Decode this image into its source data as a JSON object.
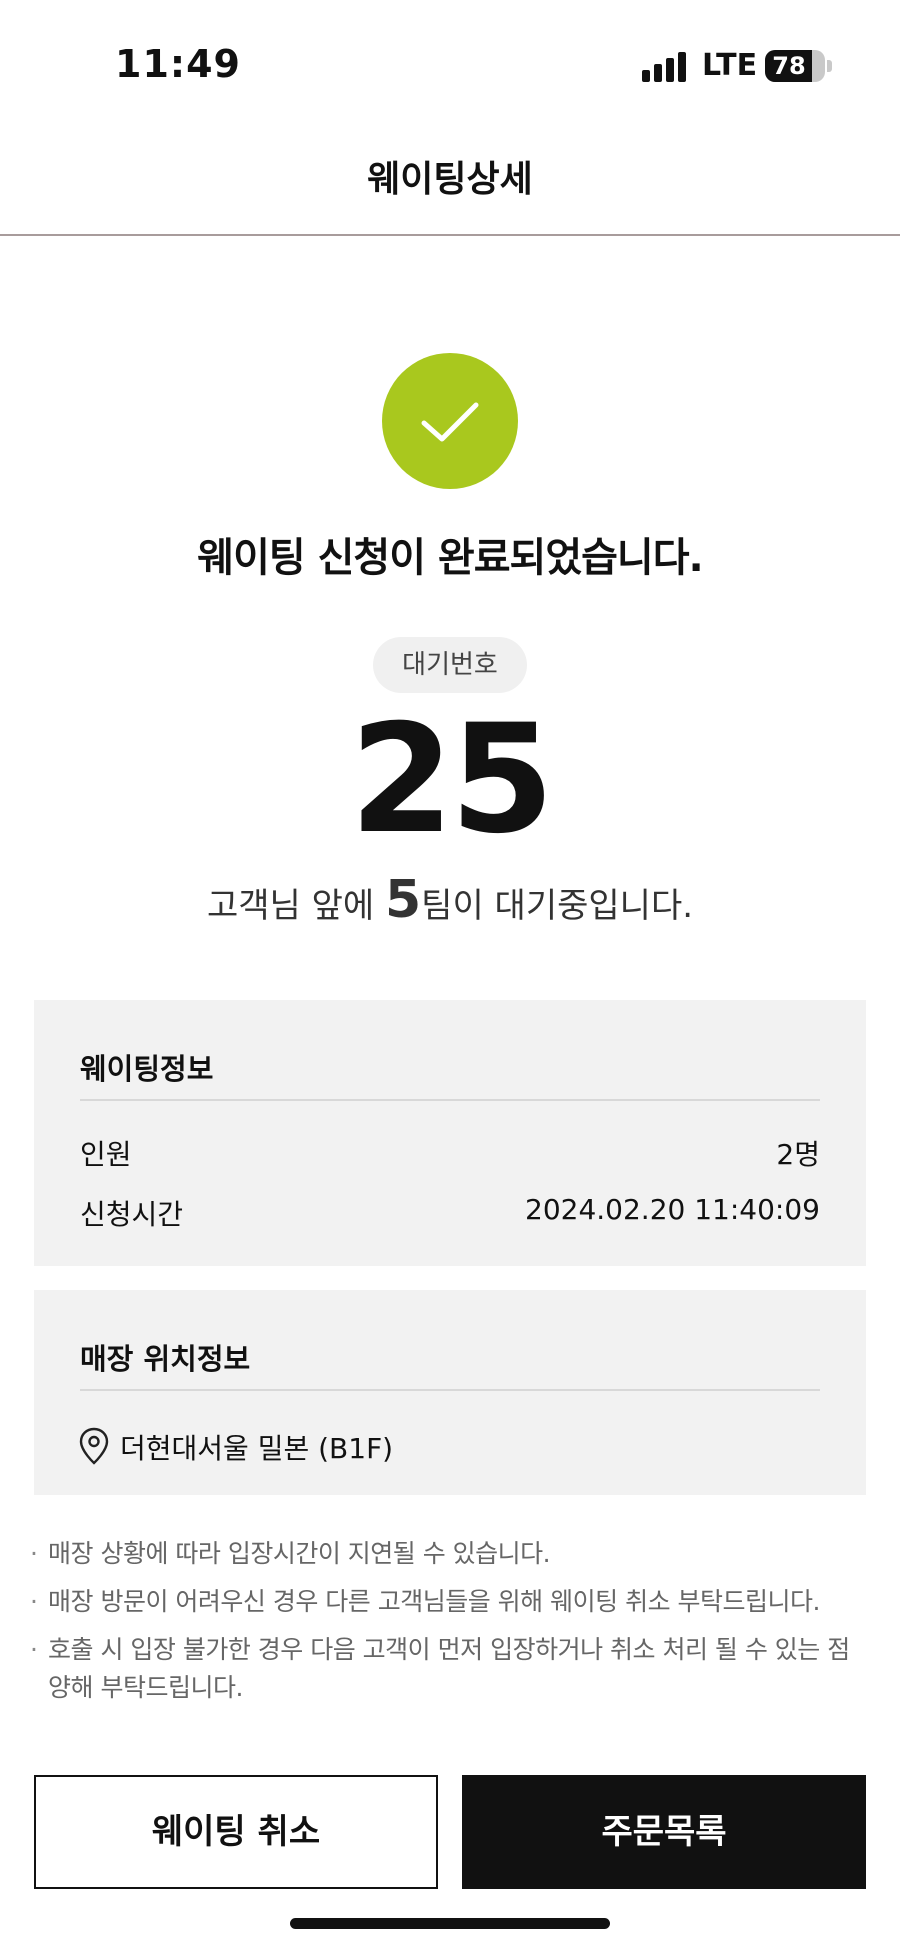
{
  "status_bar": {
    "time": "11:49",
    "network": "LTE",
    "battery_percent": "78",
    "battery_level": 0.78
  },
  "header": {
    "title": "웨이팅상세"
  },
  "result": {
    "icon": "check-icon",
    "accent_color": "#a9c81e",
    "title": "웨이팅 신청이 완료되었습니다.",
    "badge_label": "대기번호",
    "wait_number": "25",
    "queue_prefix": "고객님 앞에 ",
    "queue_count": "5",
    "queue_suffix": "팀이 대기중입니다."
  },
  "waiting_info": {
    "title": "웨이팅정보",
    "people_label": "인원",
    "people_value": "2명",
    "time_label": "신청시간",
    "time_value": "2024.02.20 11:40:09"
  },
  "store_location": {
    "title": "매장 위치정보",
    "icon": "location-pin-icon",
    "location": "더현대서울 밀본 (B1F)"
  },
  "notes": [
    "매장 상황에 따라 입장시간이 지연될 수 있습니다.",
    "매장 방문이 어려우신 경우 다른 고객님들을 위해 웨이팅 취소 부탁드립니다.",
    "호출 시 입장 불가한 경우 다음 고객이 먼저 입장하거나 취소 처리 될 수 있는 점 양해 부탁드립니다."
  ],
  "buttons": {
    "cancel_label": "웨이팅 취소",
    "orders_label": "주문목록"
  }
}
